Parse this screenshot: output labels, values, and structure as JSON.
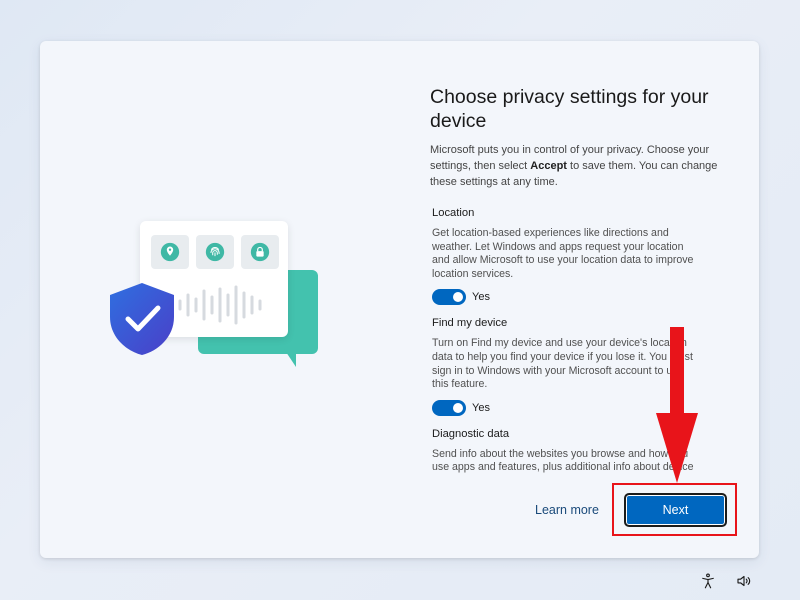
{
  "dialog": {
    "title": "Choose privacy settings for your device",
    "intro_part1": "Microsoft puts you in control of your privacy. Choose your settings, then select ",
    "intro_bold": "Accept",
    "intro_part2": " to save them. You can change these settings at any time.",
    "sections": [
      {
        "title": "Location",
        "description": "Get location-based experiences like directions and weather. Let Windows and apps request your location and allow Microsoft to use your location data to improve location services.",
        "toggle_state": "on",
        "toggle_label": "Yes"
      },
      {
        "title": "Find my device",
        "description": "Turn on Find my device and use your device's location data to help you find your device if you lose it. You must sign in to Windows with your Microsoft account to use this feature.",
        "toggle_state": "on",
        "toggle_label": "Yes"
      },
      {
        "title": "Diagnostic data",
        "description": "Send info about the websites you browse and how you use apps and features, plus additional info about device health, device activity, and enhanced error reporting."
      }
    ],
    "learn_more_label": "Learn more",
    "next_label": "Next"
  },
  "illustration": {
    "icons": [
      "location-pin-icon",
      "fingerprint-icon",
      "lock-icon",
      "shield-check-icon",
      "voice-wave-icon"
    ]
  },
  "system_tray": {
    "icons": [
      "accessibility-icon",
      "volume-icon"
    ]
  },
  "colors": {
    "accent": "#0067c0",
    "annotation_red": "#e8141a",
    "card_bg": "#f3f6fb",
    "teal": "#43c2ae",
    "shield_blue": "#3b5fd9"
  }
}
